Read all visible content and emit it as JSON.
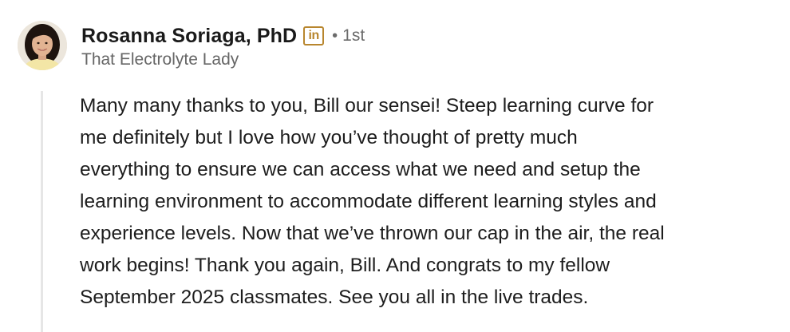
{
  "author": {
    "name": "Rosanna Soriaga, PhD",
    "badge_icon": "linkedin-badge-icon",
    "badge_text": "in",
    "separator": "•",
    "degree": "1st",
    "headline": "That Electrolyte Lady"
  },
  "comment": {
    "lines": [
      "Many many thanks to you, Bill our sensei! Steep learning curve for",
      "me definitely but I love how you’ve thought of pretty much",
      "everything to ensure we can access what we need and setup the",
      "learning environment to accommodate different learning styles and",
      "experience levels. Now that we’ve thrown our cap in the air, the real",
      "work begins! Thank you again, Bill. And congrats to my fellow",
      "September 2025 classmates. See you all in the live trades."
    ]
  },
  "colors": {
    "badge": "#b8862e",
    "muted_text": "#666666",
    "thread_line": "#e6e6e6"
  }
}
